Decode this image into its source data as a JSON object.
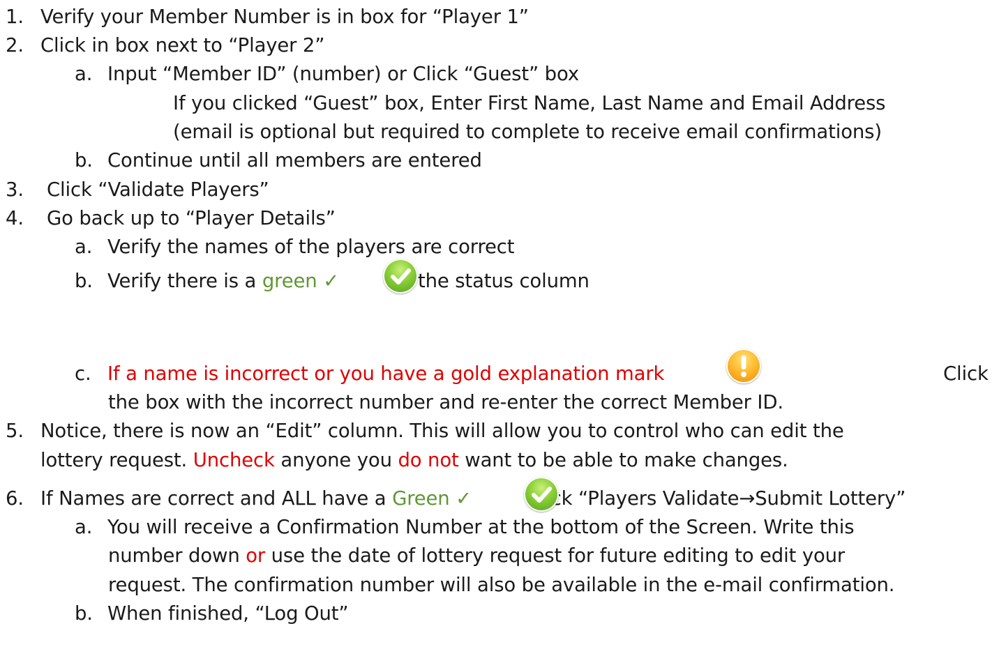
{
  "steps": {
    "s1": {
      "num": "1.",
      "text": "Verify your Member Number is in box for “Player 1”"
    },
    "s2": {
      "num": "2.",
      "text": "Click in box next to “Player 2”"
    },
    "s2a": {
      "num": "a.",
      "text": "Input “Member ID” (number) or Click “Guest” box"
    },
    "s2a_note1": "If you clicked “Guest” box, Enter First Name, Last Name and Email Address",
    "s2a_note2": "(email is optional but required to complete to receive email confirmations)",
    "s2b": {
      "num": "b.",
      "text": "Continue until all members are entered"
    },
    "s3": {
      "num": "3.",
      "text": "Click “Validate Players”"
    },
    "s4": {
      "num": "4.",
      "text": "Go back up to “Player Details”"
    },
    "s4a": {
      "num": "a.",
      "text": "Verify the names of the players are correct"
    },
    "s4b": {
      "num": "b.",
      "text_pre": "Verify there is a ",
      "green_word": "green ✓",
      "text_post": " in the status column"
    },
    "s4c": {
      "num": "c.",
      "red_text": "If a name is incorrect or you have a gold explanation mark",
      "click": "Click",
      "line2": "the box with the incorrect number and re-enter the correct Member ID."
    },
    "s5": {
      "num": "5.",
      "line1": "Notice, there is now an “Edit” column.  This will allow you to control who can edit the",
      "line2_pre": "lottery request.  ",
      "uncheck": "Uncheck",
      "line2_mid": " anyone you ",
      "do_not": "do not",
      "line2_post": " want to be able to make changes."
    },
    "s6": {
      "num": "6.",
      "text_pre": "If Names are correct and ALL have a ",
      "green_word": "Green ✓",
      "text_post": " Click “Players Validate→Submit Lottery”"
    },
    "s6a": {
      "num": "a.",
      "line1": "You will receive a Confirmation Number at the bottom of the Screen. Write this",
      "line2_pre": "number down ",
      "or_word": "or",
      "line2_post": " use the date of lottery request for future editing to edit your",
      "line3": "request.  The confirmation number will also be available in the e-mail confirmation."
    },
    "s6b": {
      "num": "b.",
      "text": "When finished, “Log Out”"
    }
  },
  "icons": {
    "check": "green-check-circle-icon",
    "warning": "gold-exclamation-circle-icon"
  },
  "colors": {
    "red": "#e00000",
    "green": "#5f9735",
    "text": "#1a1a1a"
  }
}
